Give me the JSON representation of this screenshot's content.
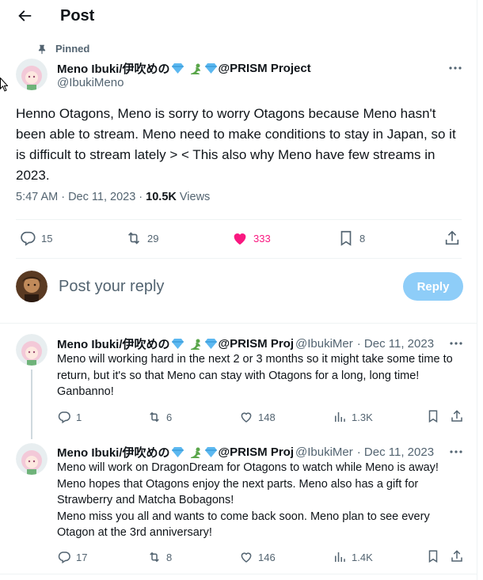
{
  "header": {
    "title": "Post"
  },
  "pinned_label": "Pinned",
  "main_post": {
    "author_name": "Meno Ibuki/伊吹めの",
    "author_suffix": "@PRISM Project",
    "handle": "@IbukiMeno",
    "text": "Henno Otagons, Meno is sorry to worry Otagons because Meno hasn't been able to stream. Meno need to make conditions to stay in Japan, so it is difficult to stream lately > < This also why Meno have few streams in 2023.",
    "time": "5:47 AM · Dec 11, 2023 · ",
    "views_count": "10.5K",
    "views_label": " Views",
    "replies": "15",
    "reposts": "29",
    "likes": "333",
    "bookmarks": "8"
  },
  "reply_composer": {
    "placeholder": "Post your reply",
    "button_label": "Reply"
  },
  "replies": [
    {
      "author_name": "Meno Ibuki/伊吹めの",
      "author_suffix": "@PRISM Proj",
      "handle": "@IbukiMer",
      "date": "· Dec 11, 2023",
      "text": "Meno will working hard in the next 2 or 3 months so it might take some time to return, but it's so that Meno can stay with Otagons for a long, long time! Ganbanno!",
      "replies": "1",
      "reposts": "6",
      "likes": "148",
      "views": "1.3K"
    },
    {
      "author_name": "Meno Ibuki/伊吹めの",
      "author_suffix": "@PRISM Proj",
      "handle": "@IbukiMer",
      "date": "· Dec 11, 2023",
      "text": "Meno will work on DragonDream for Otagons to watch while Meno is away! Meno hopes that Otagons enjoy the next parts. Meno also has a gift for Strawberry and Matcha Bobagons!\nMeno miss you all and wants to come back soon. Meno plan to see every Otagon at the 3rd anniversary!",
      "replies": "17",
      "reposts": "8",
      "likes": "146",
      "views": "1.4K"
    }
  ],
  "colors": {
    "accent": "#1d9bf0",
    "like_pink": "#f91880",
    "muted": "#536471",
    "reply_button": "#8ecdf8"
  }
}
